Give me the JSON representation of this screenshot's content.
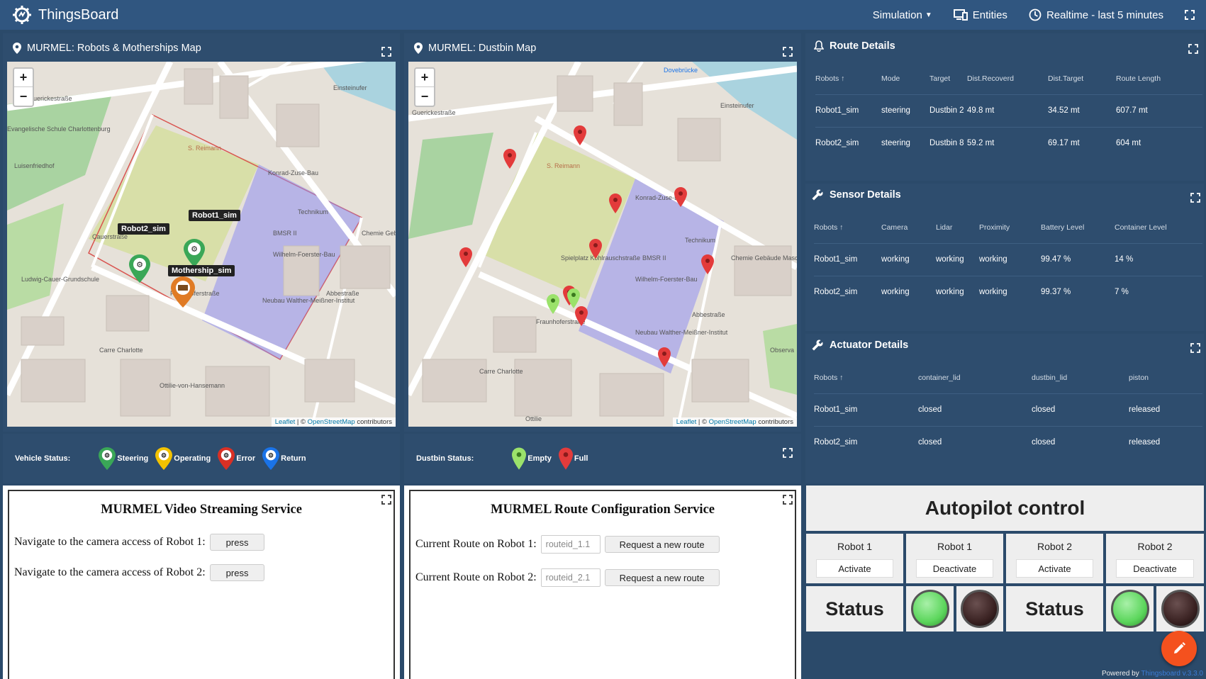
{
  "app": {
    "logo_text": "ThingsBoard",
    "simulation_label": "Simulation",
    "entities_label": "Entities",
    "realtime_label": "Realtime - last 5 minutes"
  },
  "map1": {
    "title": "MURMEL: Robots & Motherships Map",
    "labels": {
      "robot2": "Robot2_sim",
      "robot1": "Robot1_sim",
      "mothership": "Mothership_sim"
    },
    "streets": [
      "Guerickestraße",
      "Evangelische Schule Charlottenburg",
      "Luisenfriedhof",
      "S. Reimann",
      "Konrad-Zuse-Bau",
      "Technikum",
      "BMSR II",
      "Wilhelm-Foerster-Bau",
      "Fraunhoferstraße",
      "Abbestraße",
      "Chemie Gebäude Maschi",
      "Ludwig-Cauer-Grundschule",
      "Neubau Walther-Meißner-Institut",
      "Carre Charlotte",
      "Ottilie-von-Hansemann",
      "Einsteinufer",
      "Cauerstraße"
    ]
  },
  "map2": {
    "title": "MURMEL: Dustbin Map",
    "streets": [
      "Guerickestraße",
      "Dovebrücke",
      "S. Reimann",
      "Konrad-Zuse-Bau",
      "Technikum",
      "BMSR II",
      "Wilhelm-Foerster-Bau",
      "Fraunhoferstraße",
      "Abbestraße",
      "Chemie Gebäude Maschinenhaus",
      "Spielplatz Kohlrauschstraße",
      "Neubau Walther-Meißner-Institut",
      "Carre Charlotte",
      "Observa",
      "Einsteinufer",
      "Ottilie"
    ]
  },
  "attribution": {
    "leaflet": "Leaflet",
    "sep": " | © ",
    "osm": "OpenStreetMap",
    "rest": " contributors"
  },
  "vehicle_legend": {
    "label": "Vehicle Status:",
    "items": [
      {
        "name": "Steering",
        "color": "#3aa757"
      },
      {
        "name": "Operating",
        "color": "#f2c200"
      },
      {
        "name": "Error",
        "color": "#d93025"
      },
      {
        "name": "Return",
        "color": "#1a73e8"
      }
    ]
  },
  "dustbin_legend": {
    "label": "Dustbin Status:",
    "items": [
      {
        "name": "Empty",
        "color": "#9be26b"
      },
      {
        "name": "Full",
        "color": "#e33b3b"
      }
    ]
  },
  "video_service": {
    "title": "MURMEL Video Streaming Service",
    "row1": "Navigate to the camera access of Robot 1:",
    "row2": "Navigate to the camera access of Robot 2:",
    "button": "press"
  },
  "route_service": {
    "title": "MURMEL Route Configuration Service",
    "row1": "Current Route on Robot 1:",
    "row2": "Current Route on Robot 2:",
    "placeholder1": "routeid_1.1",
    "placeholder2": "routeid_2.1",
    "button": "Request a new route"
  },
  "route_details": {
    "title": "Route Details",
    "headers": [
      "Robots ↑",
      "Mode",
      "Target",
      "Dist.Recoverd",
      "Dist.Target",
      "Route Length"
    ],
    "rows": [
      [
        "Robot1_sim",
        "steering",
        "Dustbin 2",
        "49.8 mt",
        "34.52 mt",
        "607.7 mt"
      ],
      [
        "Robot2_sim",
        "steering",
        "Dustbin 8",
        "59.2 mt",
        "69.17 mt",
        "604 mt"
      ]
    ]
  },
  "sensor_details": {
    "title": "Sensor Details",
    "headers": [
      "Robots ↑",
      "Camera",
      "Lidar",
      "Proximity",
      "Battery Level",
      "Container Level"
    ],
    "rows": [
      [
        "Robot1_sim",
        "working",
        "working",
        "working",
        "99.47 %",
        "14 %"
      ],
      [
        "Robot2_sim",
        "working",
        "working",
        "working",
        "99.37 %",
        "7 %"
      ]
    ]
  },
  "actuator_details": {
    "title": "Actuator Details",
    "headers": [
      "Robots ↑",
      "container_lid",
      "dustbin_lid",
      "piston"
    ],
    "rows": [
      [
        "Robot1_sim",
        "closed",
        "closed",
        "released"
      ],
      [
        "Robot2_sim",
        "closed",
        "closed",
        "released"
      ]
    ]
  },
  "autopilot": {
    "title": "Autopilot control",
    "cells": [
      {
        "robot": "Robot 1",
        "action": "Activate"
      },
      {
        "robot": "Robot 1",
        "action": "Deactivate"
      },
      {
        "robot": "Robot 2",
        "action": "Activate"
      },
      {
        "robot": "Robot 2",
        "action": "Deactivate"
      }
    ],
    "status_label": "Status",
    "lamp_on_color": "#5cd65c",
    "lamp_off_color": "#3a2222"
  },
  "footer": {
    "powered_by": "Powered by ",
    "product": "Thingsboard v.3.3.0"
  }
}
